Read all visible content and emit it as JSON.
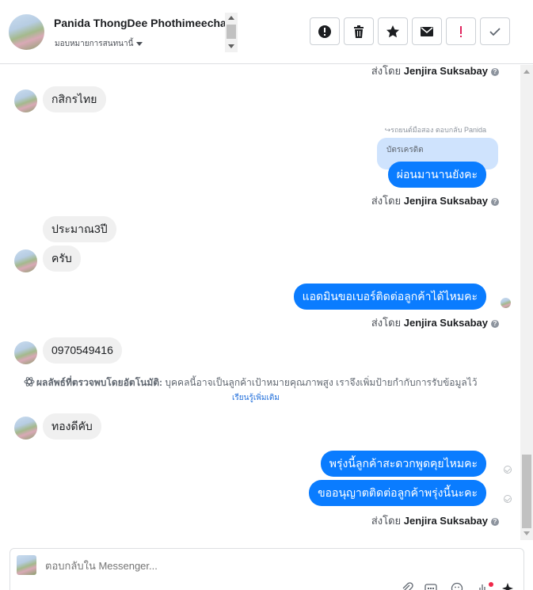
{
  "header": {
    "contact_name": "Panida ThongDee Phothimeechai",
    "assign_label": "มอบหมายการสนทนานี้",
    "actions": [
      {
        "name": "report-button",
        "icon": "exclamation-circle-icon"
      },
      {
        "name": "delete-button",
        "icon": "trash-icon"
      },
      {
        "name": "star-button",
        "icon": "star-icon"
      },
      {
        "name": "mark-unread-button",
        "icon": "envelope-icon"
      },
      {
        "name": "spam-button",
        "icon": "exclamation-icon"
      },
      {
        "name": "done-button",
        "icon": "check-icon"
      }
    ]
  },
  "messages": {
    "sentby_prefix": "ส่งโดย",
    "agent_name": "Jenjira Suksabay",
    "m1": "กสิกรไทย",
    "reply_note": "↪รถยนต์มือสอง ตอบกลับ Panida",
    "quoted": "บัตรเครดิต",
    "m2": "ผ่อนมานานยังคะ",
    "m3": "ประมาณ3ปี",
    "m4": "ครับ",
    "m5": "แอดมินขอเบอร์ติดต่อลูกค้าได้ไหมคะ",
    "m6": "0970549416",
    "auto_title": "ผลลัพธ์ที่ตรวจพบโดยอัตโนมัติ:",
    "auto_text": "บุคคลนี้อาจเป็นลูกค้าเป้าหมายคุณภาพสูง เราจึงเพิ่มป้ายกำกับการรับข้อมูลไว้",
    "learn_more": "เรียนรู้เพิ่มเติม",
    "m7": "ทองดีคับ",
    "m8": "พรุ่งนี้ลูกค้าสะดวกพูดคุยไหมคะ",
    "m9": "ขออนุญาตติดต่อลูกค้าพรุ่งนี้นะคะ"
  },
  "composer": {
    "placeholder": "ตอบกลับใน Messenger...",
    "icons": [
      "paperclip-icon",
      "gif-icon",
      "emoji-icon",
      "hand-icon",
      "sparkle-icon"
    ]
  },
  "colors": {
    "outgoing": "#0a7cff",
    "incoming": "#f0f0f0",
    "quoted": "#cfe3fd"
  }
}
